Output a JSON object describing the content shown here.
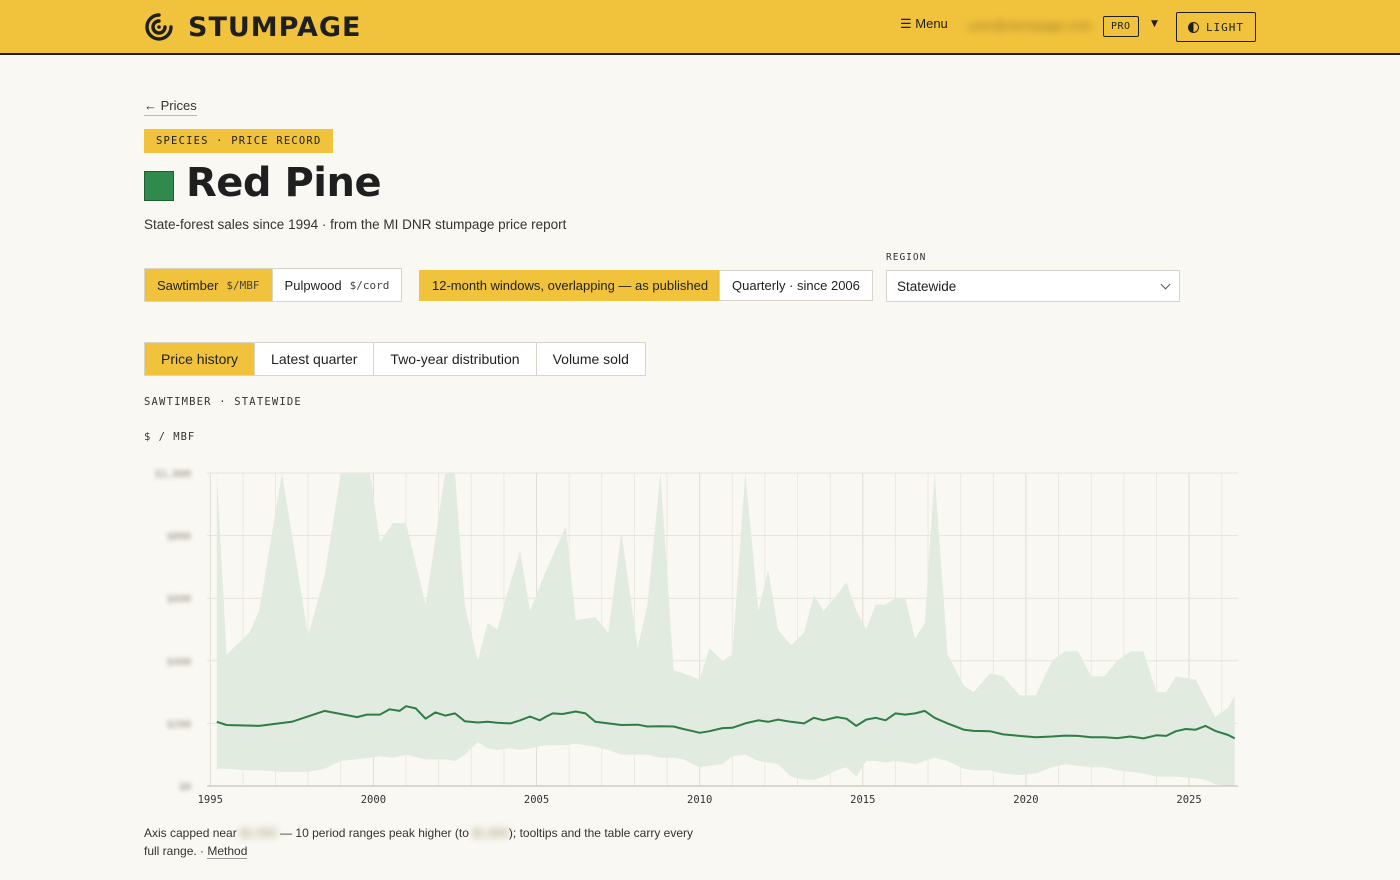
{
  "header": {
    "brand": "STUMPAGE",
    "menu_label": "☰ Menu",
    "account_email": "user@stumpage.com",
    "plan_badge": "PRO",
    "theme_label": "LIGHT"
  },
  "nav": {
    "back_label": "← Prices"
  },
  "page": {
    "kicker": "SPECIES · PRICE RECORD",
    "title": "Red Pine",
    "species_color": "#2f8a4b",
    "subtitle": "State-forest sales since 1994 · from the MI DNR stumpage price report"
  },
  "controls": {
    "product": [
      {
        "label": "Sawtimber",
        "unit": "$/MBF",
        "selected": true
      },
      {
        "label": "Pulpwood",
        "unit": "$/cord",
        "selected": false
      }
    ],
    "windows": [
      {
        "label": "12-month windows, overlapping — as published",
        "selected": true
      },
      {
        "label": "Quarterly · since 2006",
        "selected": false
      }
    ],
    "region_label": "REGION",
    "region_value": "Statewide"
  },
  "tabs": [
    "Price history",
    "Latest quarter",
    "Two-year distribution",
    "Volume sold"
  ],
  "series_label": "SAWTIMBER · STATEWIDE",
  "unit_label": "$ / MBF",
  "note": {
    "t1": "Axis capped near ",
    "v1": "$1,000",
    "t2": " — 10 period ranges peak higher (to ",
    "v2": "$1,800",
    "t3": "); tooltips and the table carry every full range. · ",
    "method": "Method"
  },
  "colors": {
    "accent": "#f1c33c",
    "line": "#2f7d45",
    "band": "#e1ebe0"
  },
  "chart_data": {
    "type": "line",
    "xlim": [
      1994.9,
      2026.5
    ],
    "ylim": [
      0,
      1000
    ],
    "x_ticks": [
      1995,
      2000,
      2005,
      2010,
      2015,
      2020,
      2025
    ],
    "y_ticks": [
      0,
      200,
      400,
      600,
      800,
      1000
    ],
    "y_tick_labels": [
      "$0",
      "$200",
      "$400",
      "$600",
      "$800",
      "$1,000"
    ],
    "series": [
      {
        "values": [
          [
            1995.2,
            205
          ],
          [
            1995.5,
            195
          ],
          [
            1996.5,
            192
          ],
          [
            1997.5,
            205
          ],
          [
            1998.5,
            240
          ],
          [
            1999.5,
            220
          ],
          [
            1999.8,
            228
          ],
          [
            2000.2,
            228
          ],
          [
            2000.5,
            245
          ],
          [
            2000.8,
            240
          ],
          [
            2001.0,
            255
          ],
          [
            2001.3,
            248
          ],
          [
            2001.6,
            215
          ],
          [
            2001.9,
            235
          ],
          [
            2002.2,
            225
          ],
          [
            2002.5,
            232
          ],
          [
            2002.8,
            207
          ],
          [
            2003.2,
            203
          ],
          [
            2003.5,
            205
          ],
          [
            2003.8,
            202
          ],
          [
            2004.2,
            200
          ],
          [
            2004.5,
            210
          ],
          [
            2004.8,
            222
          ],
          [
            2005.1,
            210
          ],
          [
            2005.3,
            222
          ],
          [
            2005.5,
            232
          ],
          [
            2005.8,
            230
          ],
          [
            2006.2,
            238
          ],
          [
            2006.5,
            232
          ],
          [
            2006.8,
            205
          ],
          [
            2007.2,
            200
          ],
          [
            2007.6,
            195
          ],
          [
            2008.1,
            196
          ],
          [
            2008.4,
            190
          ],
          [
            2008.8,
            191
          ],
          [
            2009.2,
            190
          ],
          [
            2009.5,
            182
          ],
          [
            2009.8,
            175
          ],
          [
            2010.0,
            170
          ],
          [
            2010.3,
            175
          ],
          [
            2010.7,
            185
          ],
          [
            2011.0,
            186
          ],
          [
            2011.4,
            200
          ],
          [
            2011.8,
            210
          ],
          [
            2012.1,
            205
          ],
          [
            2012.4,
            212
          ],
          [
            2012.8,
            205
          ],
          [
            2013.2,
            200
          ],
          [
            2013.5,
            218
          ],
          [
            2013.8,
            210
          ],
          [
            2014.2,
            220
          ],
          [
            2014.5,
            215
          ],
          [
            2014.8,
            192
          ],
          [
            2015.1,
            212
          ],
          [
            2015.4,
            218
          ],
          [
            2015.7,
            210
          ],
          [
            2016.0,
            232
          ],
          [
            2016.3,
            228
          ],
          [
            2016.6,
            232
          ],
          [
            2016.9,
            240
          ],
          [
            2017.2,
            218
          ],
          [
            2017.6,
            200
          ],
          [
            2018.1,
            180
          ],
          [
            2018.4,
            176
          ],
          [
            2018.9,
            175
          ],
          [
            2019.3,
            165
          ],
          [
            2019.8,
            160
          ],
          [
            2020.3,
            156
          ],
          [
            2020.8,
            158
          ],
          [
            2021.2,
            161
          ],
          [
            2021.6,
            160
          ],
          [
            2022.0,
            156
          ],
          [
            2022.4,
            156
          ],
          [
            2022.8,
            153
          ],
          [
            2023.2,
            158
          ],
          [
            2023.6,
            152
          ],
          [
            2024.0,
            162
          ],
          [
            2024.3,
            160
          ],
          [
            2024.6,
            175
          ],
          [
            2024.9,
            182
          ],
          [
            2025.2,
            180
          ],
          [
            2025.5,
            192
          ],
          [
            2025.8,
            176
          ],
          [
            2026.2,
            163
          ],
          [
            2026.4,
            152
          ]
        ]
      }
    ],
    "band": [
      {
        "x": 1995.2,
        "lo": 55,
        "hi": 1000
      },
      {
        "x": 1995.5,
        "lo": 55,
        "hi": 420
      },
      {
        "x": 1996.2,
        "lo": 50,
        "hi": 490
      },
      {
        "x": 1996.5,
        "lo": 50,
        "hi": 560
      },
      {
        "x": 1997.2,
        "lo": 45,
        "hi": 1000
      },
      {
        "x": 1998.0,
        "lo": 45,
        "hi": 480
      },
      {
        "x": 1998.5,
        "lo": 55,
        "hi": 670
      },
      {
        "x": 1999.0,
        "lo": 80,
        "hi": 1000
      },
      {
        "x": 1999.9,
        "lo": 90,
        "hi": 1000
      },
      {
        "x": 2000.2,
        "lo": 95,
        "hi": 780
      },
      {
        "x": 2000.6,
        "lo": 90,
        "hi": 840
      },
      {
        "x": 2001.0,
        "lo": 100,
        "hi": 840
      },
      {
        "x": 2001.6,
        "lo": 85,
        "hi": 580
      },
      {
        "x": 2002.2,
        "lo": 85,
        "hi": 1000
      },
      {
        "x": 2002.5,
        "lo": 80,
        "hi": 1000
      },
      {
        "x": 2002.8,
        "lo": 100,
        "hi": 580
      },
      {
        "x": 2003.2,
        "lo": 140,
        "hi": 400
      },
      {
        "x": 2003.5,
        "lo": 120,
        "hi": 520
      },
      {
        "x": 2003.8,
        "lo": 115,
        "hi": 500
      },
      {
        "x": 2004.2,
        "lo": 120,
        "hi": 650
      },
      {
        "x": 2004.5,
        "lo": 115,
        "hi": 750
      },
      {
        "x": 2004.8,
        "lo": 120,
        "hi": 560
      },
      {
        "x": 2005.3,
        "lo": 130,
        "hi": 690
      },
      {
        "x": 2005.9,
        "lo": 130,
        "hi": 830
      },
      {
        "x": 2006.2,
        "lo": 135,
        "hi": 530
      },
      {
        "x": 2006.8,
        "lo": 125,
        "hi": 540
      },
      {
        "x": 2007.2,
        "lo": 115,
        "hi": 490
      },
      {
        "x": 2007.6,
        "lo": 100,
        "hi": 810
      },
      {
        "x": 2008.1,
        "lo": 100,
        "hi": 440
      },
      {
        "x": 2008.4,
        "lo": 100,
        "hi": 580
      },
      {
        "x": 2008.8,
        "lo": 90,
        "hi": 1000
      },
      {
        "x": 2009.2,
        "lo": 90,
        "hi": 370
      },
      {
        "x": 2009.5,
        "lo": 85,
        "hi": 360
      },
      {
        "x": 2010.0,
        "lo": 60,
        "hi": 340
      },
      {
        "x": 2010.3,
        "lo": 65,
        "hi": 440
      },
      {
        "x": 2010.7,
        "lo": 70,
        "hi": 400
      },
      {
        "x": 2011.0,
        "lo": 95,
        "hi": 420
      },
      {
        "x": 2011.4,
        "lo": 100,
        "hi": 1000
      },
      {
        "x": 2011.8,
        "lo": 80,
        "hi": 560
      },
      {
        "x": 2012.1,
        "lo": 75,
        "hi": 690
      },
      {
        "x": 2012.4,
        "lo": 70,
        "hi": 500
      },
      {
        "x": 2012.8,
        "lo": 30,
        "hi": 450
      },
      {
        "x": 2013.2,
        "lo": 20,
        "hi": 490
      },
      {
        "x": 2013.5,
        "lo": 20,
        "hi": 610
      },
      {
        "x": 2013.8,
        "lo": 30,
        "hi": 560
      },
      {
        "x": 2014.2,
        "lo": 50,
        "hi": 610
      },
      {
        "x": 2014.5,
        "lo": 60,
        "hi": 650
      },
      {
        "x": 2014.8,
        "lo": 30,
        "hi": 560
      },
      {
        "x": 2015.1,
        "lo": 80,
        "hi": 500
      },
      {
        "x": 2015.4,
        "lo": 80,
        "hi": 580
      },
      {
        "x": 2015.7,
        "lo": 75,
        "hi": 580
      },
      {
        "x": 2016.0,
        "lo": 80,
        "hi": 600
      },
      {
        "x": 2016.3,
        "lo": 75,
        "hi": 600
      },
      {
        "x": 2016.6,
        "lo": 70,
        "hi": 470
      },
      {
        "x": 2016.9,
        "lo": 80,
        "hi": 520
      },
      {
        "x": 2017.2,
        "lo": 90,
        "hi": 1000
      },
      {
        "x": 2017.6,
        "lo": 80,
        "hi": 420
      },
      {
        "x": 2018.1,
        "lo": 55,
        "hi": 320
      },
      {
        "x": 2018.4,
        "lo": 50,
        "hi": 300
      },
      {
        "x": 2018.9,
        "lo": 50,
        "hi": 360
      },
      {
        "x": 2019.3,
        "lo": 40,
        "hi": 350
      },
      {
        "x": 2019.8,
        "lo": 35,
        "hi": 290
      },
      {
        "x": 2020.3,
        "lo": 40,
        "hi": 290
      },
      {
        "x": 2020.8,
        "lo": 60,
        "hi": 400
      },
      {
        "x": 2021.2,
        "lo": 70,
        "hi": 430
      },
      {
        "x": 2021.6,
        "lo": 65,
        "hi": 430
      },
      {
        "x": 2022.0,
        "lo": 60,
        "hi": 350
      },
      {
        "x": 2022.4,
        "lo": 60,
        "hi": 350
      },
      {
        "x": 2022.8,
        "lo": 50,
        "hi": 400
      },
      {
        "x": 2023.2,
        "lo": 45,
        "hi": 430
      },
      {
        "x": 2023.6,
        "lo": 40,
        "hi": 430
      },
      {
        "x": 2024.0,
        "lo": 30,
        "hi": 300
      },
      {
        "x": 2024.3,
        "lo": 30,
        "hi": 300
      },
      {
        "x": 2024.6,
        "lo": 30,
        "hi": 350
      },
      {
        "x": 2025.2,
        "lo": 25,
        "hi": 340
      },
      {
        "x": 2025.5,
        "lo": 20,
        "hi": 280
      },
      {
        "x": 2025.8,
        "lo": 5,
        "hi": 220
      },
      {
        "x": 2026.2,
        "lo": 0,
        "hi": 250
      },
      {
        "x": 2026.4,
        "lo": 0,
        "hi": 290
      }
    ]
  }
}
